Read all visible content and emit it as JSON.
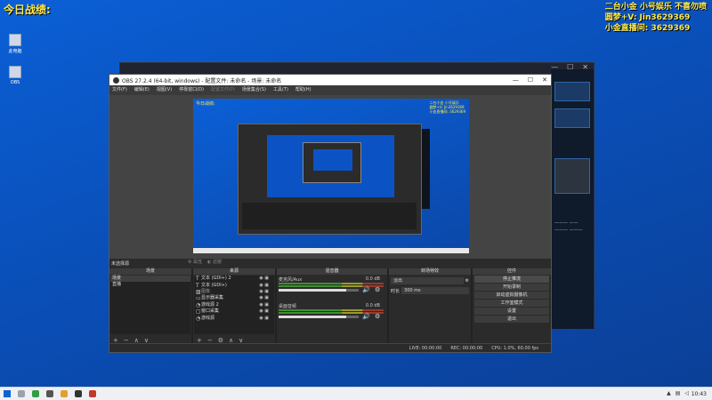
{
  "overlays": {
    "top_left": "今日战绩:",
    "top_right": [
      "二台小金 小号娱乐 不喜勿喷",
      "圆梦+V: Jin3629369",
      "小金直播间: 3629369"
    ]
  },
  "desktop_icons": [
    {
      "label": "此电脑",
      "icon": "computer-icon"
    },
    {
      "label": "OBS",
      "icon": "obs-icon"
    }
  ],
  "obs": {
    "title": "OBS 27.2.4 (64-bit, windows) - 配置文件: 未命名 - 场景: 未命名",
    "window_buttons": [
      "—",
      "☐",
      "✕"
    ],
    "menu": [
      "文件(F)",
      "编辑(E)",
      "视图(V)",
      "停靠窗口(D)",
      "配置文件(P)",
      "场景集合(S)",
      "工具(T)",
      "帮助(H)"
    ],
    "preview": {
      "overlay_left": "今日战绩:",
      "overlay_right": [
        "二台小金 小号娱乐",
        "圆梦+V: Jin3629369",
        "小金直播间: 3629369"
      ]
    },
    "status_label": "未选择源",
    "source_buttons": [
      "属性",
      "滤镜"
    ],
    "docks": {
      "scenes": {
        "title": "场景",
        "items": [
          "场景",
          "直播"
        ]
      },
      "sources": {
        "title": "来源",
        "items": [
          {
            "icon": "text-icon",
            "label": "文本 (GDI+) 2"
          },
          {
            "icon": "text-icon",
            "label": "文本 (GDI+)"
          },
          {
            "icon": "image-icon",
            "label": "图像"
          },
          {
            "icon": "monitor-icon",
            "label": "显示器采集"
          },
          {
            "icon": "eye-icon",
            "label": "游戏源 2"
          },
          {
            "icon": "window-icon",
            "label": "窗口采集"
          },
          {
            "icon": "eye-icon",
            "label": "游戏源"
          }
        ]
      },
      "mixer": {
        "title": "混音器",
        "tracks": [
          {
            "name": "麦克风/Aux",
            "db": "0.0 dB",
            "level": 0.84
          },
          {
            "name": "桌面音频",
            "db": "0.0 dB",
            "level": 0.84
          }
        ]
      },
      "transitions": {
        "title": "转场特效",
        "type": "淡出",
        "duration_label": "时长",
        "duration": "300 ms"
      },
      "controls": {
        "title": "控件",
        "buttons": [
          "停止推流",
          "开始录制",
          "启动虚拟摄像机",
          "工作室模式",
          "设置",
          "退出"
        ]
      }
    },
    "statusbar": [
      "LIVE: 00:00:00",
      "REC: 00:00:00",
      "CPU: 1.0%, 60.00 fps"
    ]
  },
  "taskbar": {
    "clock": "10:43"
  }
}
